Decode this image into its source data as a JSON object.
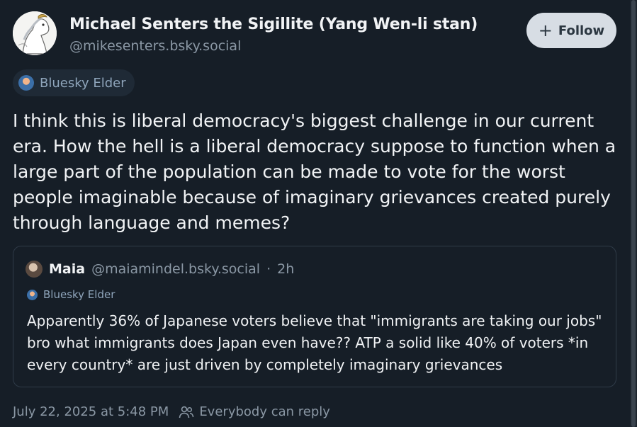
{
  "author": {
    "display_name": "Michael Senters the Sigillite (Yang Wen-li stan)",
    "handle": "@mikesenters.bsky.social",
    "badge": "Bluesky Elder"
  },
  "follow_button": {
    "label": "Follow"
  },
  "post": {
    "text": "I think this is liberal democracy's biggest challenge in our current era. How the hell is a liberal democracy suppose to function when a large part of the population can be made to vote for the worst people imaginable because of imaginary grievances created purely through language and memes?",
    "timestamp": "July 22, 2025 at 5:48 PM",
    "reply_setting": "Everybody can reply"
  },
  "quote": {
    "display_name": "Maia",
    "handle": "@maiamindel.bsky.social",
    "separator": "·",
    "age": "2h",
    "badge": "Bluesky Elder",
    "text": "Apparently 36% of Japanese voters believe that \"immigrants are taking our jobs\" bro what immigrants does Japan even have?? ATP a solid like 40% of voters *in every country* are just driven by completely imaginary grievances"
  },
  "icons": {
    "follow": "plus-icon",
    "reply_setting": "people-icon"
  },
  "colors": {
    "background": "#161e27",
    "text": "#f1f3f5",
    "muted": "#8b98a5",
    "badge_text": "#8fa5bb",
    "follow_button_bg": "#d7dde4"
  }
}
